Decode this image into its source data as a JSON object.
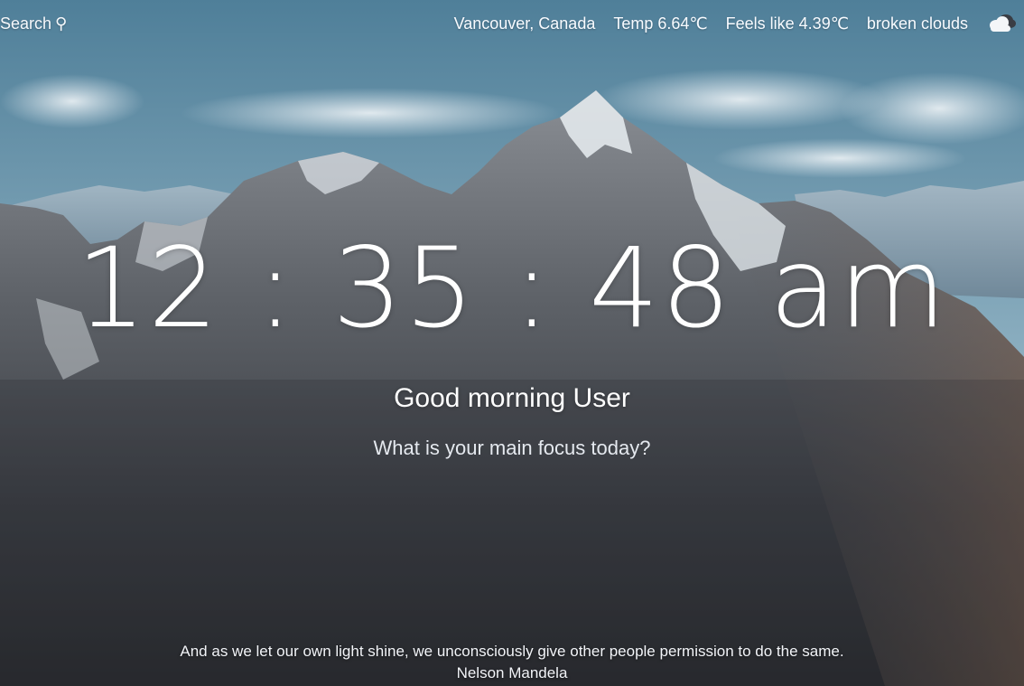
{
  "search": {
    "label": "Search",
    "icon": "location-pin-icon"
  },
  "weather": {
    "location": "Vancouver, Canada",
    "temp_label": "Temp",
    "temp_value": "6.64℃",
    "feels_label": "Feels like",
    "feels_value": "4.39℃",
    "description": "broken clouds",
    "icon": "broken-clouds-icon"
  },
  "clock": {
    "time": "12 : 35 : 48 am"
  },
  "greeting": {
    "text": "Good morning User"
  },
  "focus": {
    "prompt": "What is your main focus today?"
  },
  "quote": {
    "text": "And as we let our own light shine, we unconsciously give other people permission to do the same.",
    "author": "Nelson Mandela"
  },
  "colors": {
    "sky_top": "#4f7f99",
    "sky_bottom": "#c9d8df",
    "rock_dark": "#2f3339",
    "snow": "#e9eef2"
  }
}
